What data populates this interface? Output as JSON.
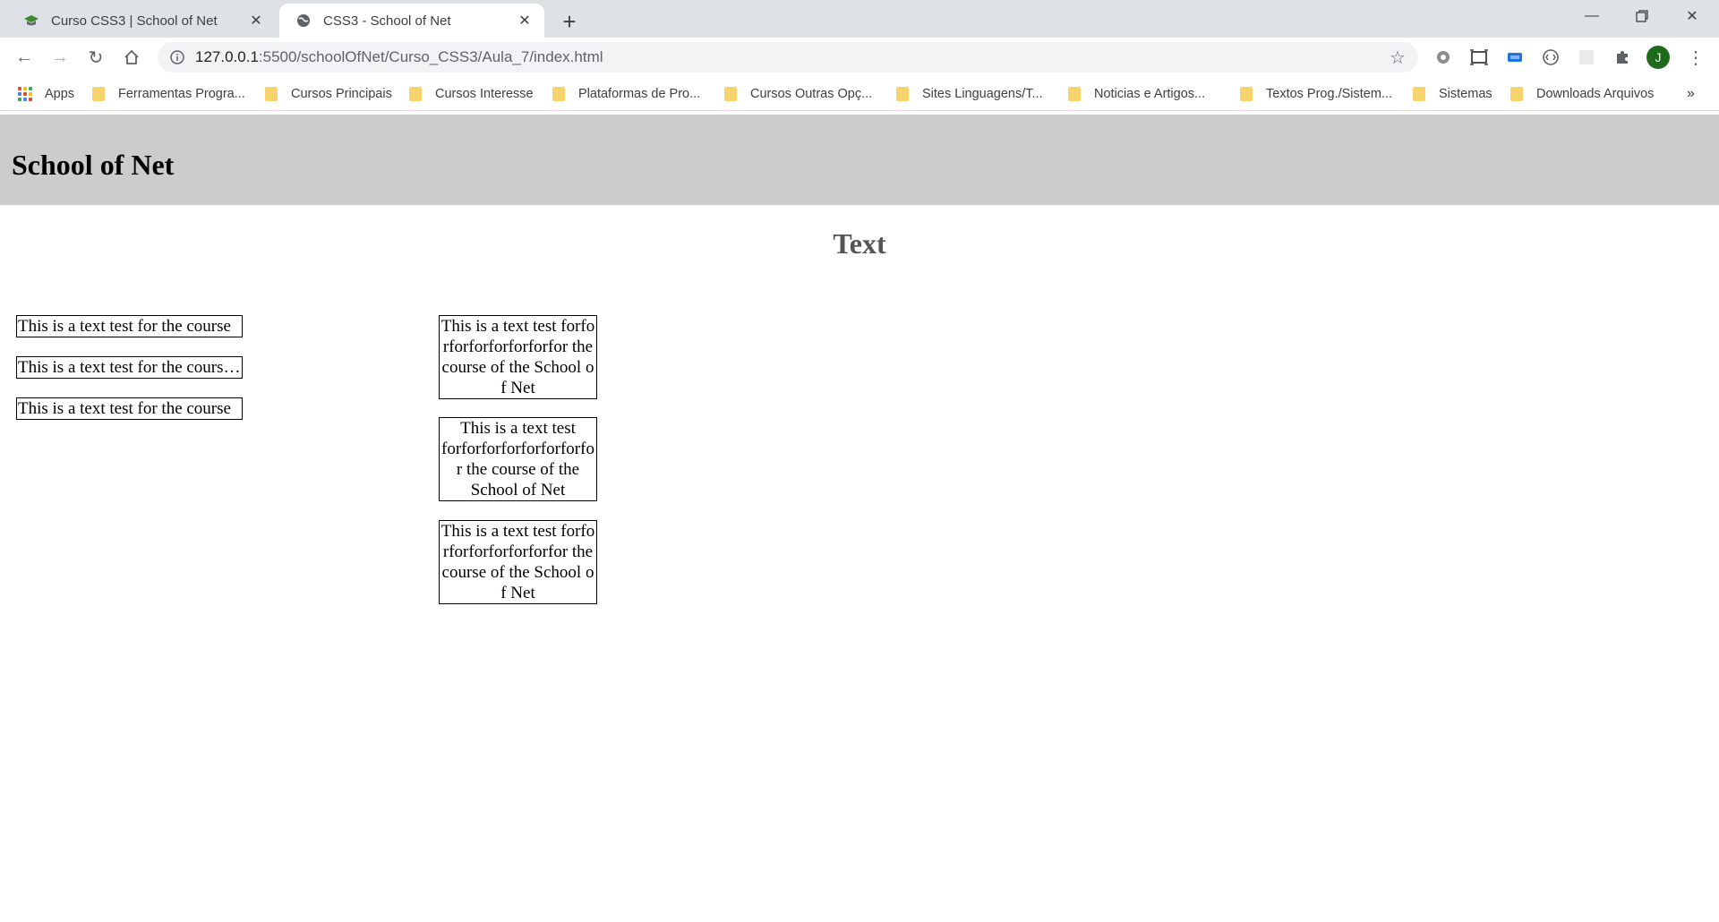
{
  "browser": {
    "tabs": [
      {
        "title": "Curso CSS3 | School of Net",
        "active": false,
        "favicon": "graduation-cap-icon"
      },
      {
        "title": "CSS3 - School of Net",
        "active": true,
        "favicon": "globe-icon"
      }
    ],
    "address": {
      "host": "127.0.0.1",
      "path": ":5500/schoolOfNet/Curso_CSS3/Aula_7/index.html"
    },
    "bookmarks": [
      "Apps",
      "Ferramentas Progra...",
      "Cursos Principais",
      "Cursos Interesse",
      "Plataformas de Pro...",
      "Cursos Outras Opç...",
      "Sites Linguagens/T...",
      "Noticias e Artigos...",
      "Textos Prog./Sistem...",
      "Sistemas",
      "Downloads Arquivos"
    ],
    "bookmarks_overflow": "»",
    "profile_initial": "J"
  },
  "page": {
    "site_title": "School of Net",
    "section_title": "Text",
    "single_line_boxes": [
      "This is a text test for the course",
      "This is a text test for the course of the School of Net",
      "This is a text test for the course"
    ],
    "wrap_boxes": [
      "This is a text test forforforforforforforfor the course of the School of Net",
      "This is a text test forforforforforforforfor the course of the School of Net",
      "This is a text test forforforforforforforfor the course of the School of Net"
    ]
  }
}
